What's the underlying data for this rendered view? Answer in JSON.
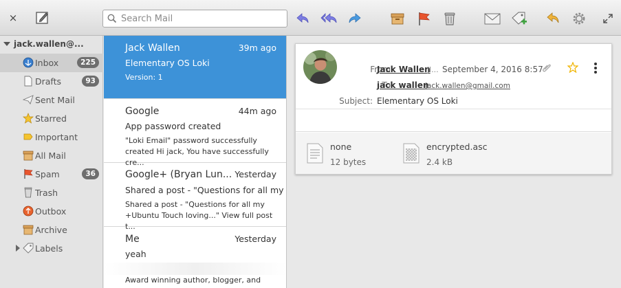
{
  "toolbar": {
    "close": "×",
    "search_placeholder": "Search Mail"
  },
  "sidebar": {
    "account": "jack.wallen@...",
    "folders": [
      {
        "label": "Inbox",
        "badge": "225",
        "icon": "inbox-icon"
      },
      {
        "label": "Drafts",
        "badge": "93",
        "icon": "drafts-icon"
      },
      {
        "label": "Sent Mail",
        "badge": "",
        "icon": "sent-icon"
      },
      {
        "label": "Starred",
        "badge": "",
        "icon": "star-icon"
      },
      {
        "label": "Important",
        "badge": "",
        "icon": "important-icon"
      },
      {
        "label": "All Mail",
        "badge": "",
        "icon": "archive-box-icon"
      },
      {
        "label": "Spam",
        "badge": "36",
        "icon": "spam-flag-icon"
      },
      {
        "label": "Trash",
        "badge": "",
        "icon": "trash-icon"
      },
      {
        "label": "Outbox",
        "badge": "",
        "icon": "outbox-icon"
      },
      {
        "label": "Archive",
        "badge": "",
        "icon": "archive-box-icon"
      },
      {
        "label": "Labels",
        "badge": "",
        "icon": "tag-icon"
      }
    ]
  },
  "messages": [
    {
      "from": "Jack Wallen",
      "time": "39m ago",
      "subject": "Elementary OS Loki",
      "preview": "Version: 1"
    },
    {
      "from": "Google",
      "time": "44m ago",
      "subject": "App password created",
      "preview": "\"Loki Email\" password successfully created Hi jack, You have successfully cre..."
    },
    {
      "from": "Google+ (Bryan Lun...",
      "time": "Yesterday",
      "subject": "Shared a post - \"Questions for all my +...",
      "preview": "Shared a post - \"Questions for all my +Ubuntu Touch loving...\" View full post t..."
    },
    {
      "from": "Me",
      "time": "Yesterday",
      "subject": "yeah",
      "preview": "Award winning author, blogger, and pod..."
    }
  ],
  "reader": {
    "from_label": "From:",
    "from_name": "Jack Wallen",
    "from_trunc": "jl...",
    "date": "September 4, 2016 8:57",
    "to_label": "To:",
    "to_name": "jack wallen",
    "to_email": "jack.wallen@gmail.com",
    "subject_label": "Subject:",
    "subject": "Elementary OS Loki",
    "attachments": [
      {
        "name": "none",
        "size": "12 bytes"
      },
      {
        "name": "encrypted.asc",
        "size": "2.4 kB"
      }
    ]
  },
  "colors": {
    "selection": "#3d92d8",
    "flag": "#e8552e",
    "star": "#f0b400"
  }
}
